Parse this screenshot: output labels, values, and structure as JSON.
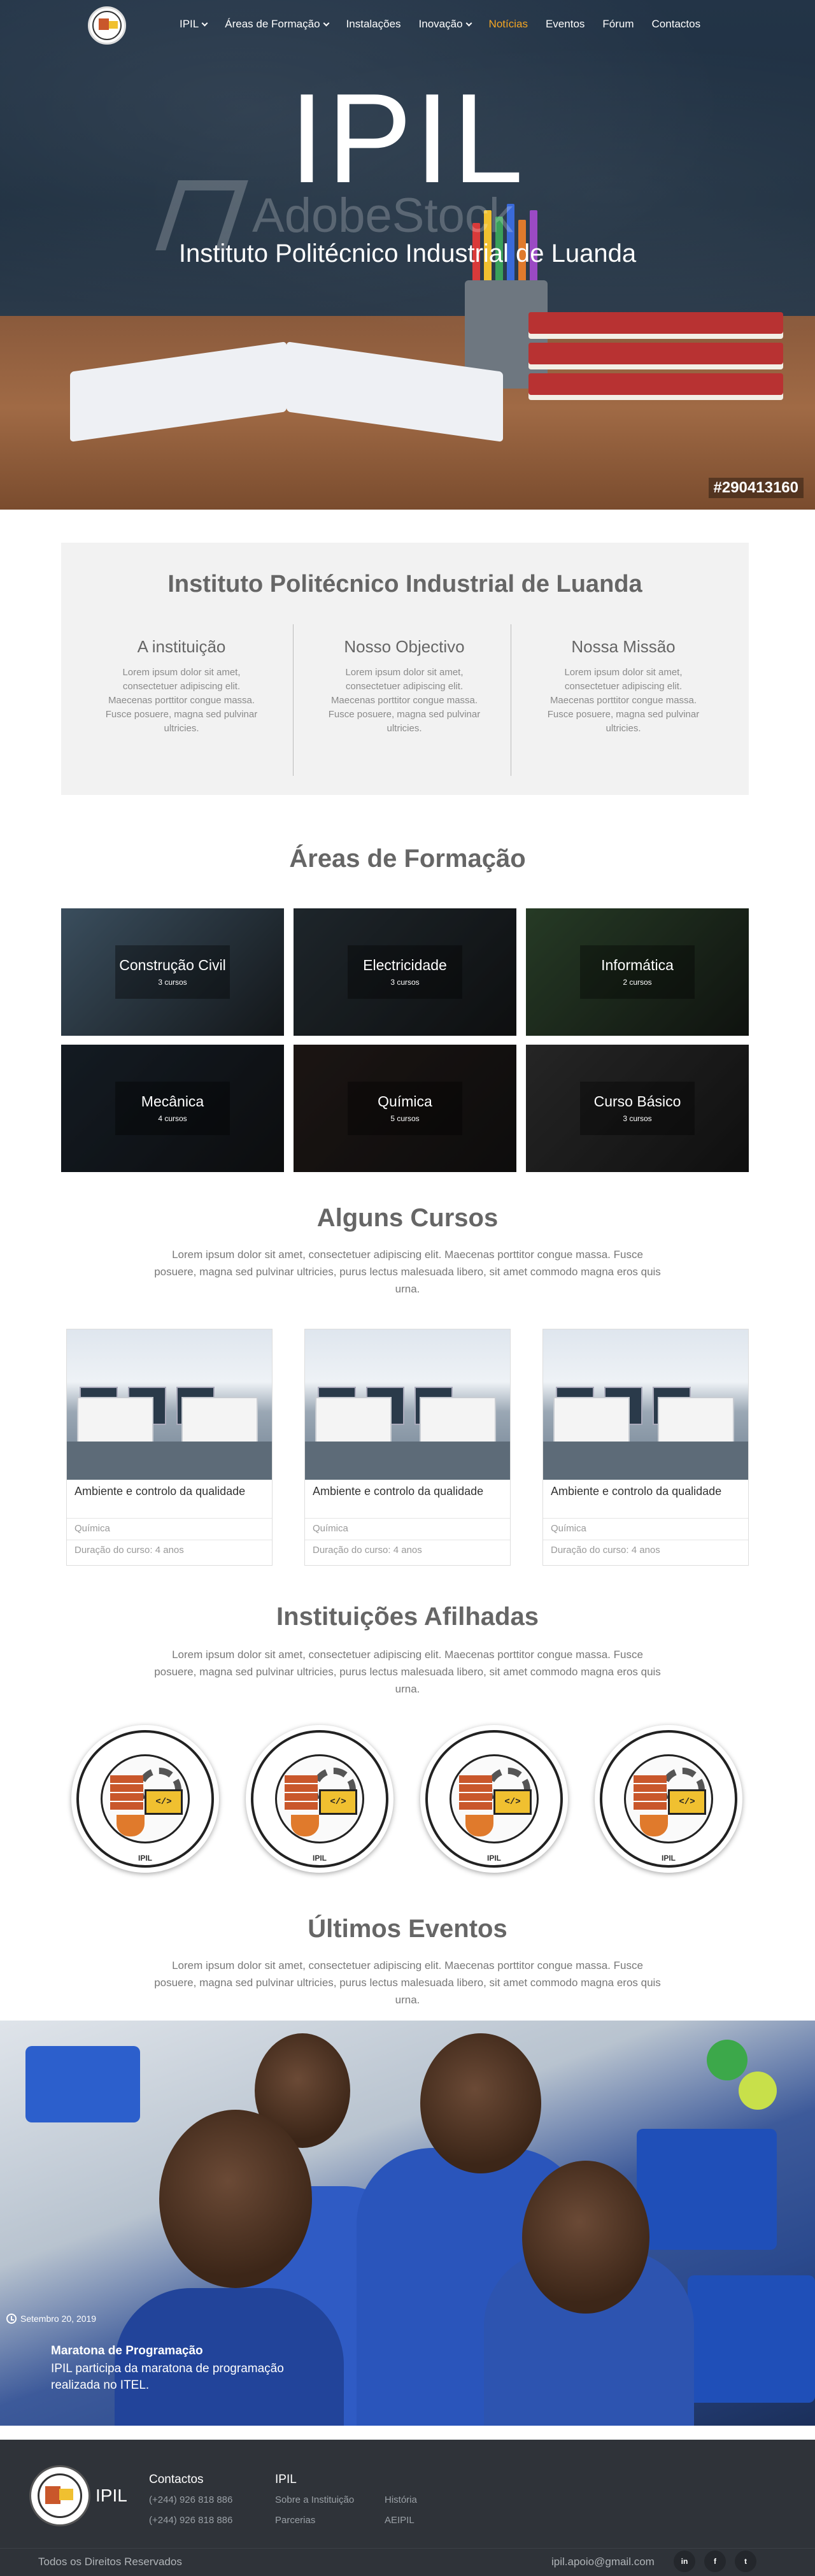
{
  "nav": {
    "items": [
      {
        "label": "IPIL",
        "has_dropdown": true
      },
      {
        "label": "Áreas de Formação",
        "has_dropdown": true
      },
      {
        "label": "Instalações",
        "has_dropdown": false
      },
      {
        "label": "Inovação",
        "has_dropdown": true
      },
      {
        "label": "Notícias",
        "has_dropdown": false,
        "active": true
      },
      {
        "label": "Eventos",
        "has_dropdown": false
      },
      {
        "label": "Fórum",
        "has_dropdown": false
      },
      {
        "label": "Contactos",
        "has_dropdown": false
      }
    ],
    "active_color": "#f5a623"
  },
  "hero": {
    "title": "IPIL",
    "subtitle": "Instituto Politécnico Industrial de Luanda",
    "watermark": "AdobeStock",
    "stock_id": "#290413160"
  },
  "about": {
    "title": "Instituto Politécnico Industrial de Luanda",
    "columns": [
      {
        "heading": "A instituição",
        "text": "Lorem ipsum dolor sit amet, consectetuer adipiscing elit. Maecenas porttitor congue massa. Fusce posuere, magna sed pulvinar ultricies."
      },
      {
        "heading": "Nosso Objectivo",
        "text": "Lorem ipsum dolor sit amet, consectetuer adipiscing elit. Maecenas porttitor congue massa. Fusce posuere, magna sed pulvinar ultricies."
      },
      {
        "heading": "Nossa Missão",
        "text": "Lorem ipsum dolor sit amet, consectetuer adipiscing elit. Maecenas porttitor congue massa. Fusce posuere, magna sed pulvinar ultricies."
      }
    ]
  },
  "areas": {
    "title": "Áreas de Formação",
    "items": [
      {
        "name": "Construção Civil",
        "count": "3 cursos",
        "color": "#5a7890"
      },
      {
        "name": "Electricidade",
        "count": "3 cursos",
        "color": "#2e3a42"
      },
      {
        "name": "Informática",
        "count": "2 cursos",
        "color": "#3b5a3a"
      },
      {
        "name": "Mecânica",
        "count": "4 cursos",
        "color": "#1f2a36"
      },
      {
        "name": "Química",
        "count": "5 cursos",
        "color": "#2a211e"
      },
      {
        "name": "Curso Básico",
        "count": "3 cursos",
        "color": "#3a3a3a"
      }
    ]
  },
  "courses": {
    "title": "Alguns Cursos",
    "lead": "Lorem ipsum dolor sit amet, consectetuer adipiscing elit. Maecenas porttitor congue massa. Fusce posuere, magna sed pulvinar ultricies, purus lectus malesuada libero, sit amet commodo magna eros quis urna.",
    "items": [
      {
        "title": "Ambiente e controlo da qualidade",
        "category": "Química",
        "duration": "Duração do curso: 4 anos"
      },
      {
        "title": "Ambiente e controlo da qualidade",
        "category": "Química",
        "duration": "Duração do curso: 4 anos"
      },
      {
        "title": "Ambiente e controlo da qualidade",
        "category": "Química",
        "duration": "Duração do curso: 4 anos"
      }
    ]
  },
  "affiliates": {
    "title": "Instituições Afilhadas",
    "lead": "Lorem ipsum dolor sit amet, consectetuer adipiscing elit. Maecenas porttitor congue massa. Fusce posuere, magna sed pulvinar ultricies, purus lectus malesuada libero, sit amet commodo magna eros quis urna.",
    "seal_text": "IPIL",
    "seal_ring_text": "INSTITUTO POLITÉCNICO INDUSTRIAL DE LUANDA",
    "seal_code": "</>"
  },
  "events": {
    "title": "Últimos Eventos",
    "lead": "Lorem ipsum dolor sit amet, consectetuer adipiscing elit. Maecenas porttitor congue massa. Fusce posuere, magna sed pulvinar ultricies, purus lectus malesuada libero, sit amet commodo magna eros quis urna.",
    "featured": {
      "date": "Setembro 20, 2019",
      "title": "Maratona de Programação",
      "description": "IPIL participa da maratona de programação realizada no ITEL."
    }
  },
  "footer": {
    "brand": "IPIL",
    "contacts_heading": "Contactos",
    "phones": [
      "(+244) 926 818 886",
      "(+244) 926 818 886"
    ],
    "ipil_heading": "IPIL",
    "links": [
      "Sobre a Instituição",
      "História",
      "Parcerias",
      "AEIPIL"
    ],
    "copyright": "Todos os Direitos Reservados",
    "email": "ipil.apoio@gmail.com",
    "social": [
      "in",
      "f",
      "t"
    ]
  }
}
